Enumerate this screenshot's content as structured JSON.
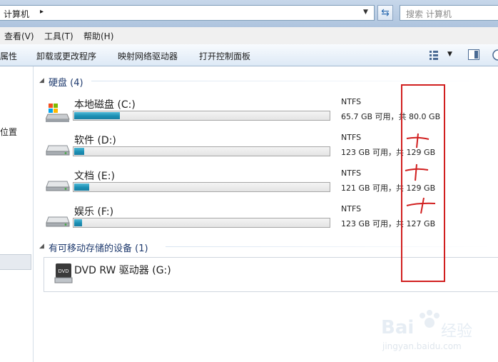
{
  "address": {
    "path": "计算机",
    "separator": "▸"
  },
  "search": {
    "placeholder": "搜索 计算机"
  },
  "menu": [
    {
      "label": "查看(V)"
    },
    {
      "label": "工具(T)"
    },
    {
      "label": "帮助(H)"
    }
  ],
  "commands": [
    {
      "label": "属性"
    },
    {
      "label": "卸载或更改程序"
    },
    {
      "label": "映射网络驱动器"
    },
    {
      "label": "打开控制面板"
    }
  ],
  "nav": {
    "partial_label": "位置"
  },
  "groups": {
    "hard_disks": {
      "title": "硬盘 (4)"
    },
    "removable": {
      "title": "有可移动存储的设备 (1)"
    }
  },
  "drives": [
    {
      "name": "本地磁盘 (C:)",
      "fs": "NTFS",
      "capacity": "65.7 GB 可用，共 80.0 GB",
      "used_fraction": 0.18,
      "icon": "windows-drive-icon"
    },
    {
      "name": "软件 (D:)",
      "fs": "NTFS",
      "capacity": "123 GB 可用，共 129 GB",
      "used_fraction": 0.04,
      "icon": "hard-drive-icon"
    },
    {
      "name": "文档 (E:)",
      "fs": "NTFS",
      "capacity": "121 GB 可用，共 129 GB",
      "used_fraction": 0.06,
      "icon": "hard-drive-icon"
    },
    {
      "name": "娱乐 (F:)",
      "fs": "NTFS",
      "capacity": "123 GB 可用，共 127 GB",
      "used_fraction": 0.03,
      "icon": "hard-drive-icon"
    }
  ],
  "removable_devices": [
    {
      "name": "DVD RW 驱动器 (G:)",
      "icon": "dvd-drive-icon",
      "icon_text": "DVD"
    }
  ],
  "watermark": {
    "brand": "Bai",
    "brand2": "经验",
    "url": "jingyan.baidu.com"
  },
  "colors": {
    "accent_bar": "#1a8fb4",
    "annotation": "#d11f1f"
  }
}
